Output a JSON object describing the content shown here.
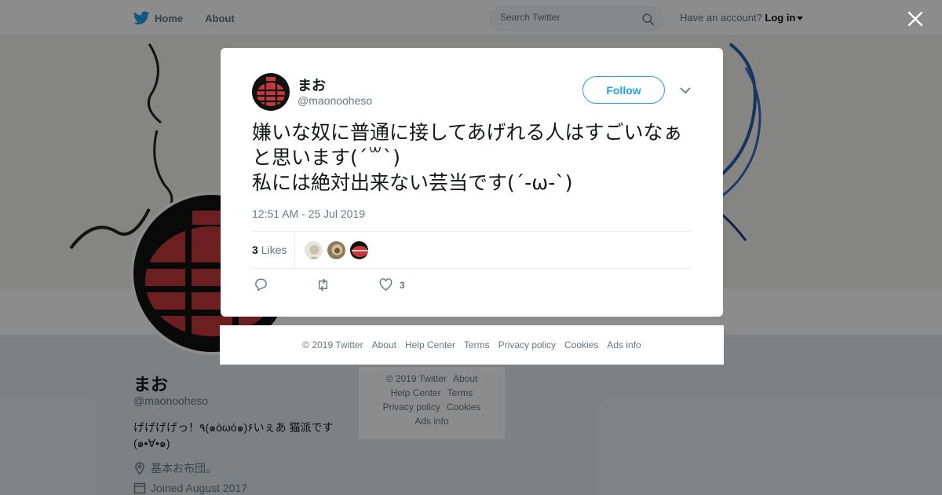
{
  "nav": {
    "home_label": "Home",
    "about_label": "About",
    "search_placeholder": "Search Twitter",
    "account_prompt": "Have an account?",
    "login_label": "Log in"
  },
  "profile": {
    "name": "まお",
    "handle": "@maonooheso",
    "bio": "げげげげっ！٩(๑òωó๑)۶いぇあ 猫派です(๑•∀•๑)",
    "location": "基本お布団。",
    "joined": "Joined August 2017",
    "footer_links": [
      "© 2019 Twitter",
      "About",
      "Help Center",
      "Terms",
      "Privacy policy",
      "Cookies",
      "Ads info"
    ]
  },
  "tweet": {
    "author_name": "まお",
    "author_handle": "@maonooheso",
    "follow_label": "Follow",
    "text": "嫌いな奴に普通に接してあげれる人はすごいなぁと思います(´꒳`)\n私には絶対出来ない芸当です(´-ω-`)",
    "timestamp": "12:51 AM - 25 Jul 2019",
    "likes_count": "3",
    "likes_label": "Likes",
    "like_action_count": "3"
  },
  "modal_footer": {
    "links": [
      "© 2019 Twitter",
      "About",
      "Help Center",
      "Terms",
      "Privacy policy",
      "Cookies",
      "Ads info"
    ]
  },
  "colors": {
    "accent": "#1da1f2",
    "text": "#14171a",
    "muted": "#657786",
    "avatar_red": "#c4393c"
  },
  "icons": [
    "twitter-bird-icon",
    "search-icon",
    "close-icon",
    "chevron-down-icon",
    "reply-icon",
    "retweet-icon",
    "heart-icon",
    "location-icon",
    "calendar-icon"
  ]
}
